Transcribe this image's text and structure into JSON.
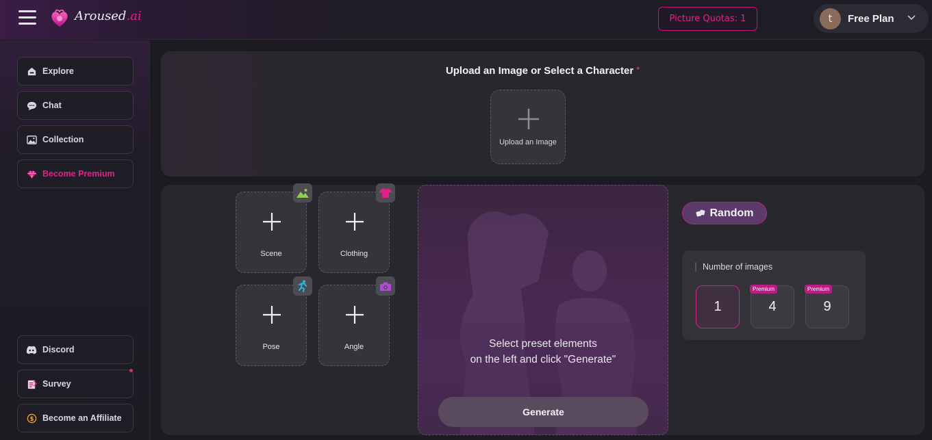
{
  "header": {
    "logo_name": "Aroused",
    "logo_suffix": ".ai",
    "quota_label": "Picture Quotas: 1",
    "plan": {
      "avatar_letter": "t",
      "label": "Free Plan"
    }
  },
  "sidebar": {
    "items": [
      {
        "label": "Explore",
        "icon": "home-icon"
      },
      {
        "label": "Chat",
        "icon": "chat-icon"
      },
      {
        "label": "Collection",
        "icon": "gallery-icon"
      },
      {
        "label": "Become Premium",
        "icon": "diamond-icon"
      }
    ],
    "bottom_items": [
      {
        "label": "Discord",
        "icon": "discord-icon"
      },
      {
        "label": "Survey",
        "icon": "survey-icon"
      },
      {
        "label": "Become an Affiliate",
        "icon": "dollar-icon"
      }
    ]
  },
  "upload": {
    "title": "Upload an Image or Select a Character",
    "required_mark": "*",
    "box_label": "Upload an Image"
  },
  "presets": [
    {
      "label": "Scene",
      "icon": "landscape-icon"
    },
    {
      "label": "Clothing",
      "icon": "shirt-icon"
    },
    {
      "label": "Pose",
      "icon": "running-figure-icon"
    },
    {
      "label": "Angle",
      "icon": "camera-icon"
    }
  ],
  "preview": {
    "hint_line1": "Select preset elements",
    "hint_line2": "on the left and click \"Generate\"",
    "generate_label": "Generate"
  },
  "random_label": "Random",
  "number_of_images": {
    "title": "Number of images",
    "options": [
      {
        "value": "1",
        "selected": true,
        "badge": ""
      },
      {
        "value": "4",
        "selected": false,
        "badge": "Premium"
      },
      {
        "value": "9",
        "selected": false,
        "badge": "Premium"
      }
    ]
  },
  "colors": {
    "accent": "#e0218a",
    "background": "#1c1b22",
    "panel": "#28272d"
  }
}
